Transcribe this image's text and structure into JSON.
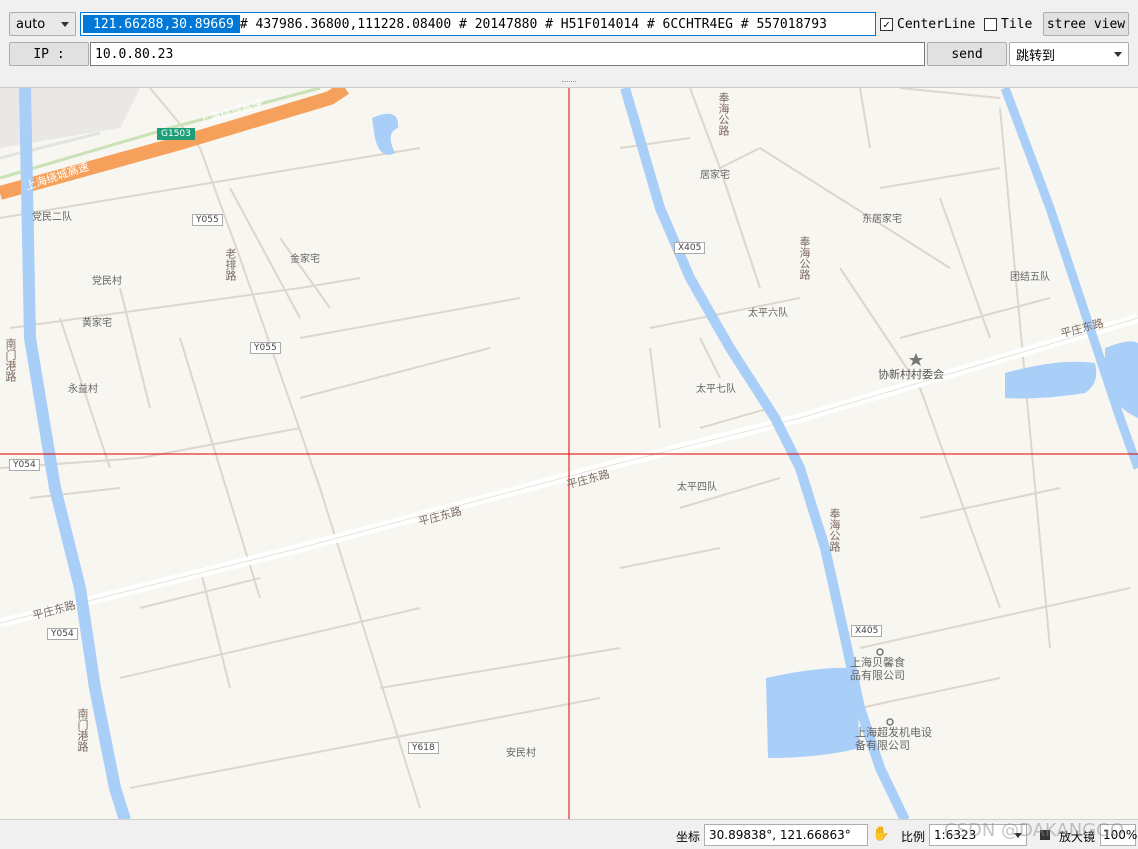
{
  "toolbar": {
    "mode_select": "auto",
    "coord_selected": "121.66288,30.89669",
    "coord_rest": "# 437986.36800,111228.08400 # 20147880 # H51F014014 # 6CCHTR4EG # 557018793",
    "centerline_label": "CenterLine",
    "centerline_checked": "✓",
    "tile_label": "Tile",
    "street_view_label": "stree view",
    "ip_label": "IP :",
    "ip_value": "10.0.80.23",
    "send_label": "send",
    "jump_select": "跳转到"
  },
  "map": {
    "labels": {
      "expressway": "上海绕城高速",
      "expressway2": "上海绕城高速",
      "g1503": "G1503",
      "dangmin2": "党民二队",
      "y055a": "Y055",
      "y055b": "Y055",
      "laopai": "老排路",
      "jinjiazhai": "金家宅",
      "dangmincun": "党民村",
      "huangjiazhai": "黄家宅",
      "nanmen1": "南门港路",
      "yongyicun": "永益村",
      "y054a": "Y054",
      "y054b": "Y054",
      "pingzhuang1": "平庄东路",
      "pingzhuang2": "平庄东路",
      "pingzhuang3": "平庄东路",
      "pingzhuang4": "平庄东路",
      "fenghai1": "奉海公路",
      "fenghai2": "奉海公路",
      "fenghai3": "奉海公路",
      "jujiazhai": "居家宅",
      "x405a": "X405",
      "x405b": "X405",
      "dongjujiazhai": "东居家宅",
      "tuanjie5": "团结五队",
      "taiping6": "太平六队",
      "xiexin": "协新村村委会",
      "taiping7": "太平七队",
      "taiping4": "太平四队",
      "beiming": "上海贝馨食品有限公司",
      "chaofa": "上海超发机电设备有限公司",
      "nanmen2": "南门港路",
      "y618": "Y618",
      "anmincun": "安民村"
    }
  },
  "status": {
    "coord_label": "坐标",
    "coord_value": "30.89838°, 121.66863°",
    "scale_label": "比例",
    "scale_value": "1:6323",
    "zoom_label": "放大镜",
    "zoom_value": "100%",
    "watermark": "CSDN @DAKANGGO"
  },
  "colors": {
    "water": "#a9cef8",
    "expressway": "#f6a15b",
    "crosshair": "#e00000",
    "background": "#f8f6f1"
  }
}
